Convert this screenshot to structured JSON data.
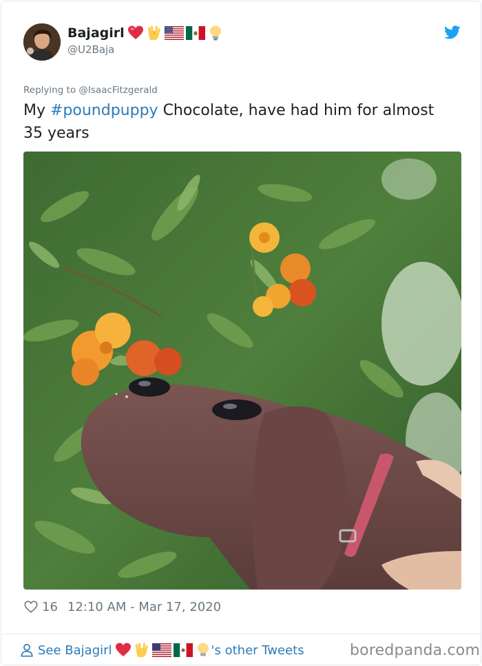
{
  "author": {
    "display_name": "Bajagirl",
    "handle": "@U2Baja",
    "name_emojis": [
      "heart-icon",
      "vulcan-salute-icon",
      "us-flag-icon",
      "mexico-flag-icon",
      "light-bulb-icon"
    ]
  },
  "tweet": {
    "replying_to": "Replying to @IsaacFitzgerald",
    "text_prefix": "My ",
    "hashtag": "#poundpuppy",
    "text_suffix": " Chocolate, have had him for almost 35 years",
    "likes": "16",
    "timestamp": "12:10 AM - Mar 17, 2020"
  },
  "footer": {
    "see_prefix": "See Bajagirl",
    "see_suffix": "'s other Tweets",
    "watermark": "boredpanda.com"
  },
  "colors": {
    "link": "#2b7bb9",
    "heart": "#e0245e",
    "muted": "#697882",
    "twitter_blue": "#1da1f2"
  }
}
